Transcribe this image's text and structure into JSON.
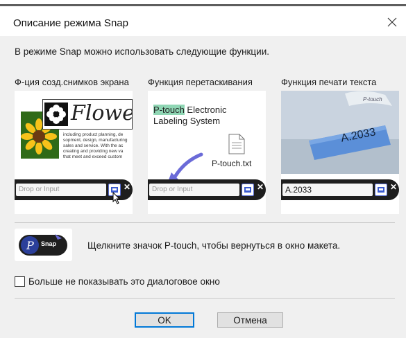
{
  "window": {
    "title": "Описание режима Snap"
  },
  "intro": "В режиме Snap можно использовать следующие функции.",
  "features": {
    "screenshot": {
      "title": "Ф-ция созд.снимков экрана",
      "flower_word": "Flower",
      "doc_text": "including product planning, de sopment, design, manufacturing sales and service. With the ac creating and providing new va that meet and exceed custom",
      "input_placeholder": "Drop or Input"
    },
    "dragdrop": {
      "title": "Функция перетаскивания",
      "highlight": "P-touch",
      "text_line1": " Electronic",
      "text_line2": "Labeling System",
      "file_name": "P-touch.txt",
      "input_placeholder": "Drop or Input"
    },
    "print": {
      "title": "Функция печати текста",
      "label_text": "A.2033",
      "tape_brand": "P-touch",
      "input_value": "A.2033"
    }
  },
  "snap": {
    "badge": "Snap",
    "instruction": "Щелкните значок P-touch, чтобы вернуться в окно макета."
  },
  "checkbox": {
    "label": "Больше не показывать это диалоговое окно",
    "checked": false
  },
  "buttons": {
    "ok": "OK",
    "cancel": "Отмена"
  },
  "colors": {
    "accent": "#0078d7",
    "button_bg": "#e1e1e1",
    "window_bg": "#f0f0f0",
    "drag_arrow": "#6b6bd8",
    "highlight": "#8fd6b4"
  }
}
